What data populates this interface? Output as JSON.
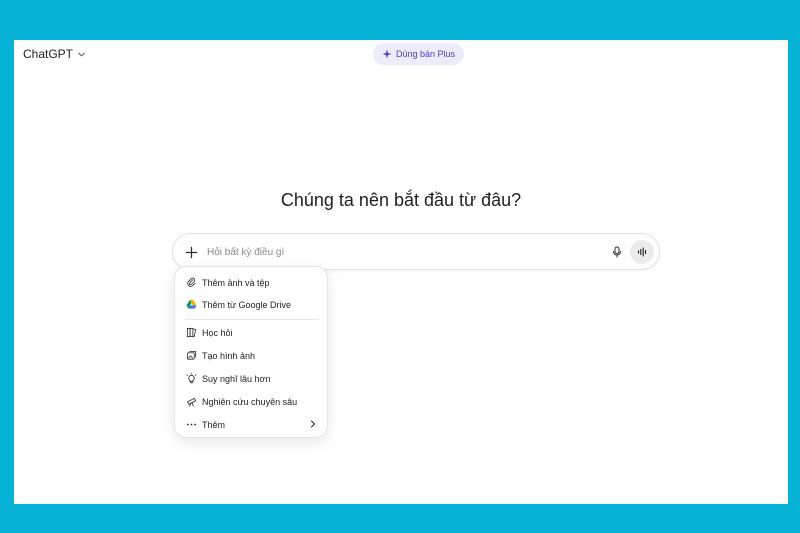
{
  "header": {
    "app_name": "ChatGPT",
    "upgrade_label": "Dùng bản Plus"
  },
  "main": {
    "headline": "Chúng ta nên bắt đầu từ đâu?"
  },
  "composer": {
    "placeholder": "Hỏi bất kỳ điều gì",
    "value": ""
  },
  "menu": {
    "items": [
      {
        "label": "Thêm ảnh và tệp",
        "icon": "paperclip-icon"
      },
      {
        "label": "Thêm từ Google Drive",
        "icon": "google-drive-icon"
      },
      {
        "label": "Học hỏi",
        "icon": "book-icon"
      },
      {
        "label": "Tạo hình ảnh",
        "icon": "image-icon"
      },
      {
        "label": "Suy nghĩ lâu hơn",
        "icon": "lightbulb-icon"
      },
      {
        "label": "Nghiên cứu chuyên sâu",
        "icon": "telescope-icon"
      },
      {
        "label": "Thêm",
        "icon": "more-dots-icon"
      }
    ]
  },
  "colors": {
    "background": "#06b3d6",
    "accent": "#4b3fc7",
    "pill_bg": "#ececfa"
  }
}
